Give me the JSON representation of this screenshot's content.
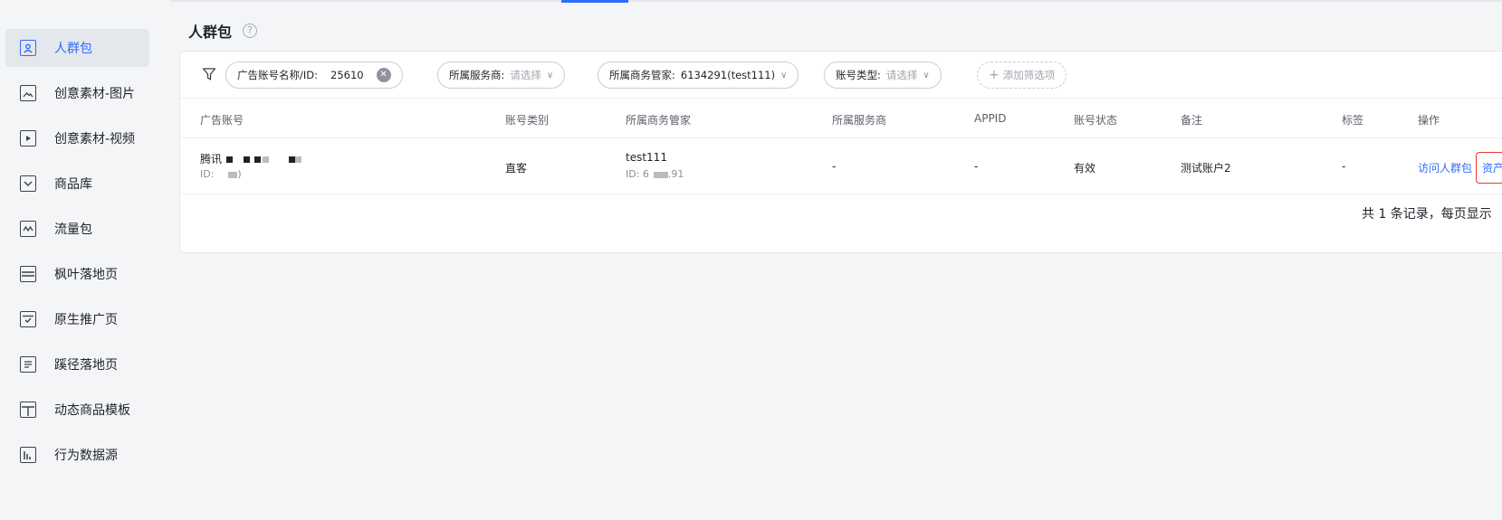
{
  "sidebar": {
    "items": [
      {
        "label": "人群包",
        "icon": "user-card-icon",
        "active": true
      },
      {
        "label": "创意素材-图片",
        "icon": "image-icon",
        "active": false
      },
      {
        "label": "创意素材-视频",
        "icon": "play-icon",
        "active": false
      },
      {
        "label": "商品库",
        "icon": "inbox-icon",
        "active": false
      },
      {
        "label": "流量包",
        "icon": "chart-icon",
        "active": false
      },
      {
        "label": "枫叶落地页",
        "icon": "list-icon",
        "active": false
      },
      {
        "label": "原生推广页",
        "icon": "check-box-icon",
        "active": false
      },
      {
        "label": "蹊径落地页",
        "icon": "document-icon",
        "active": false
      },
      {
        "label": "动态商品模板",
        "icon": "template-icon",
        "active": false
      },
      {
        "label": "行为数据源",
        "icon": "bar-chart-icon",
        "active": false
      }
    ]
  },
  "header": {
    "title": "人群包",
    "help": "?"
  },
  "filters": {
    "account": {
      "key": "广告账号名称/ID:",
      "value": "25610",
      "clear": "✕"
    },
    "provider": {
      "key": "所属服务商:",
      "value": "请选择",
      "chevron": "∨"
    },
    "manager": {
      "key": "所属商务管家:",
      "value": "6134291(test111)",
      "chevron": "∨"
    },
    "type": {
      "key": "账号类型:",
      "value": "请选择",
      "chevron": "∨"
    },
    "add": {
      "plus": "+",
      "label": "添加筛选项"
    }
  },
  "table": {
    "headers": [
      "广告账号",
      "账号类别",
      "所属商务管家",
      "所属服务商",
      "APPID",
      "账号状态",
      "备注",
      "标签",
      "操作"
    ],
    "row": {
      "account_name": "腾讯",
      "account_id": "ID:",
      "account_id_tail": ")",
      "category": "直客",
      "manager_name": "test111",
      "manager_id": "ID: 6",
      "manager_id_tail": ".91",
      "provider": "-",
      "appid": "-",
      "status": "有效",
      "remark": "测试账户2",
      "tag": "-",
      "action_visit": "访问人群包",
      "action_asset": "资产"
    }
  },
  "pager": {
    "summary": "共 1 条记录，每页显示"
  },
  "colors": {
    "accent": "#2f6bff",
    "highlight_border": "#e03a2f"
  }
}
